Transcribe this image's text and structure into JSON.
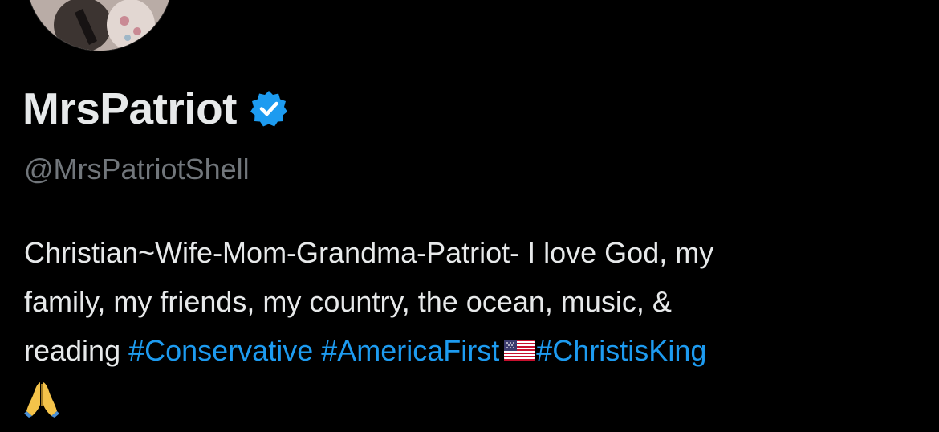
{
  "profile": {
    "display_name": "MrsPatriot",
    "handle": "@MrsPatriotShell",
    "verified_icon": "verified-badge-icon",
    "avatar_icon": "profile-avatar"
  },
  "bio": {
    "line1": "Christian~Wife-Mom-Grandma-Patriot- I love God, my",
    "line2": "family, my friends, my country, the ocean, music, &",
    "line3_text": "reading",
    "hashtags": [
      "#Conservative",
      "#AmericaFirst",
      "#ChristisKing"
    ],
    "flag_icon": "us-flag-icon",
    "pray_icon": "folded-hands-icon"
  },
  "colors": {
    "background": "#000000",
    "text": "#e7e9ea",
    "secondary_text": "#71767b",
    "link": "#1d9bf0",
    "verified": "#1d9bf0"
  }
}
